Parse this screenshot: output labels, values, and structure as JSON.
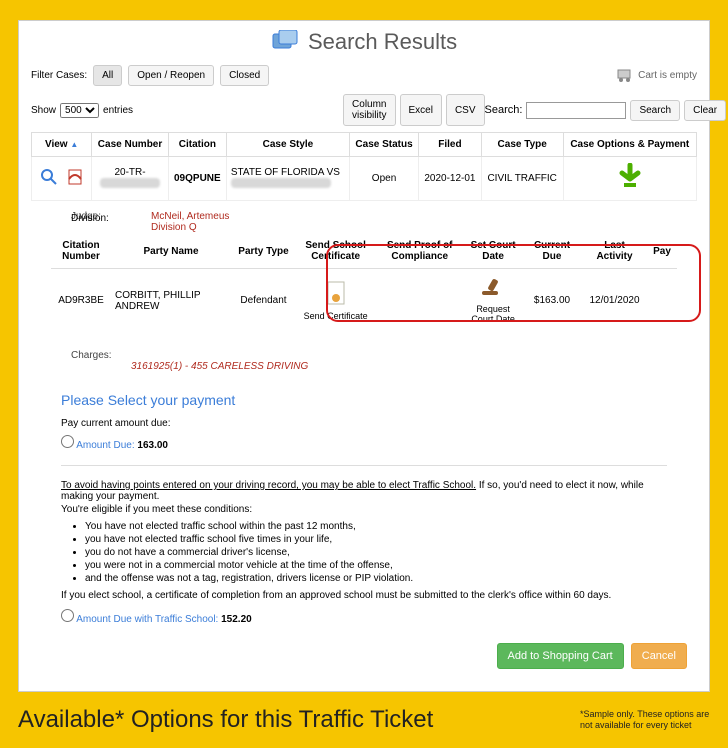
{
  "header": {
    "title": "Search Results"
  },
  "filters": {
    "label": "Filter Cases:",
    "tabs": [
      "All",
      "Open / Reopen",
      "Closed"
    ],
    "cart_text": "Cart is empty"
  },
  "toolbar": {
    "show_prefix": "Show",
    "show_suffix": "entries",
    "show_value": "500",
    "buttons": [
      "Column visibility",
      "Excel",
      "CSV"
    ],
    "search_label": "Search:",
    "search_btn": "Search",
    "clear_btn": "Clear"
  },
  "table": {
    "columns": [
      "View",
      "Case Number",
      "Citation",
      "Case Style",
      "Case Status",
      "Filed",
      "Case Type",
      "Case Options & Payment"
    ],
    "row": {
      "case_number_prefix": "20-TR-",
      "citation": "09QPUNE",
      "case_style": "STATE OF FLORIDA VS",
      "status": "Open",
      "filed": "2020-12-01",
      "case_type": "CIVIL TRAFFIC"
    }
  },
  "meta": {
    "judge_label": "Judge:",
    "judge_value": "McNeil, Artemeus",
    "division_label": "Division:",
    "division_value": "Division Q"
  },
  "subtable": {
    "columns": [
      "Citation Number",
      "Party Name",
      "Party Type",
      "Send School Certificate",
      "Send Proof of Compliance",
      "Set Court Date",
      "Current Due",
      "Last Activity",
      "Pay"
    ],
    "row": {
      "citation_number": "AD9R3BE",
      "party_name": "CORBITT, PHILLIP ANDREW",
      "party_type": "Defendant",
      "send_cert_label": "Send Certificate",
      "set_court_label": "Request Court Date",
      "current_due": "$163.00",
      "last_activity": "12/01/2020"
    }
  },
  "charges": {
    "label": "Charges:",
    "value": "3161925(1) - 455 CARELESS DRIVING"
  },
  "payment": {
    "title": "Please Select your payment",
    "pay_current_label": "Pay current amount due:",
    "amount_due_label": "Amount Due:",
    "amount_due_value": "163.00",
    "info_underline": "To avoid having points entered on your driving record, you may be able to elect Traffic School.",
    "info_rest": " If so, you'd need to elect it now, while making your payment.",
    "eligible_lead": "You're eligible if you meet these conditions:",
    "conditions": [
      "You have not elected traffic school within the past 12 months,",
      "you have not elected traffic school five times in your life,",
      "you do not have a commercial driver's license,",
      "you were not in a commercial motor vehicle at the time of the offense,",
      "and the offense was not a tag, registration, drivers license or PIP violation."
    ],
    "elect_note": "If you elect school, a certificate of completion from an approved school must be submitted to the clerk's office within 60 days.",
    "amount_school_label": "Amount Due with Traffic School:",
    "amount_school_value": "152.20",
    "add_cart": "Add to Shopping Cart",
    "cancel": "Cancel"
  },
  "footer": {
    "big": "Available* Options for this Traffic Ticket",
    "small": "*Sample only. These options are not available for every ticket"
  }
}
